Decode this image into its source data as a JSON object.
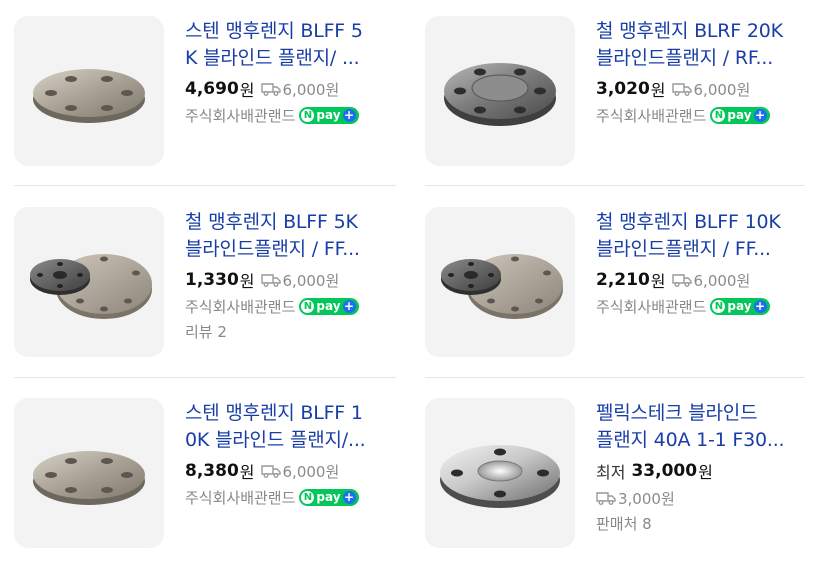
{
  "currency": "원",
  "products": [
    {
      "title_line1": "스텐 맹후렌지 BLFF 5",
      "title_line2": "K 블라인드 플랜지/ ...",
      "price_prefix": "",
      "price": "4,690",
      "shipping": "6,000원",
      "seller": "주식회사배관랜드",
      "npay": true,
      "extra": "",
      "image": "stainless-flange"
    },
    {
      "title_line1": "철 맹후렌지 BLRF 20K",
      "title_line2": "블라인드플랜지 / RF...",
      "price_prefix": "",
      "price": "3,020",
      "shipping": "6,000원",
      "seller": "주식회사배관랜드",
      "npay": true,
      "extra": "",
      "image": "steel-rf-flange"
    },
    {
      "title_line1": "철 맹후렌지 BLFF 5K",
      "title_line2": "블라인드플랜지 / FF...",
      "price_prefix": "",
      "price": "1,330",
      "shipping": "6,000원",
      "seller": "주식회사배관랜드",
      "npay": true,
      "extra": "리뷰 2",
      "image": "two-flanges"
    },
    {
      "title_line1": "철 맹후렌지 BLFF 10K",
      "title_line2": "블라인드플랜지 / FF...",
      "price_prefix": "",
      "price": "2,210",
      "shipping": "6,000원",
      "seller": "주식회사배관랜드",
      "npay": true,
      "extra": "",
      "image": "two-flanges"
    },
    {
      "title_line1": "스텐 맹후렌지 BLFF 1",
      "title_line2": "0K 블라인드 플랜지/...",
      "price_prefix": "",
      "price": "8,380",
      "shipping": "6,000원",
      "seller": "주식회사배관랜드",
      "npay": true,
      "extra": "",
      "image": "stainless-flange"
    },
    {
      "title_line1": "펠릭스테크 블라인드",
      "title_line2": "플랜지 40A 1-1 F30...",
      "price_prefix": "최저",
      "price": "33,000",
      "shipping": "3,000원",
      "seller": "",
      "npay": false,
      "extra": "판매처 8",
      "image": "polished-flange"
    }
  ],
  "npay_label": "pay",
  "icons": {
    "shipping": "truck-icon",
    "npay": "npay-badge-icon"
  },
  "colors": {
    "title": "#1a3ea8",
    "npay_green": "#03c75a",
    "npay_plus": "#1e6ff0",
    "muted": "#888888",
    "thumb_bg": "#f3f3f4"
  }
}
